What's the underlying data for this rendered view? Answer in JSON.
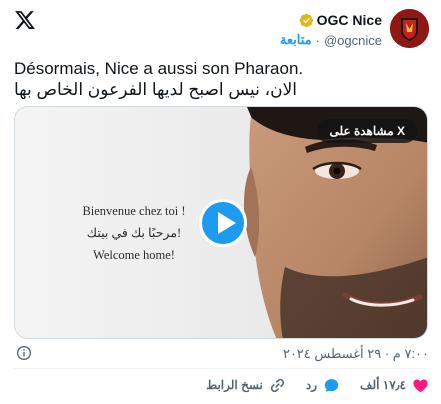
{
  "author": {
    "name": "OGC Nice",
    "handle": "@ogcnice",
    "follow_label": "متابعة",
    "separator": "·"
  },
  "tweet": {
    "line_fr": "Désormais, Nice a aussi son Pharaon.",
    "line_ar": "الان، نيس اصبح لديها الفرعون الخاص بها"
  },
  "media": {
    "watch_label": "مشاهدة على X",
    "welcome_lines": [
      "Bienvenue chez toi !",
      "مرحبًا بك في بيتك!",
      "Welcome home!"
    ]
  },
  "meta": {
    "timestamp": "٧:٠٠ م · ٢٩ أغسطس ٢٠٢٤"
  },
  "actions": {
    "like_count": "١٧٫٤ ألف",
    "reply_label": "رد",
    "copy_link_label": "نسخ الرابط"
  },
  "colors": {
    "accent": "#1d9bf0",
    "like": "#f91880",
    "verified": "#e2b719",
    "avatar": "#8f1714"
  },
  "icons": [
    "x-logo-icon",
    "verified-badge-icon",
    "info-icon",
    "heart-icon",
    "reply-bubble-icon",
    "link-icon",
    "play-icon"
  ]
}
